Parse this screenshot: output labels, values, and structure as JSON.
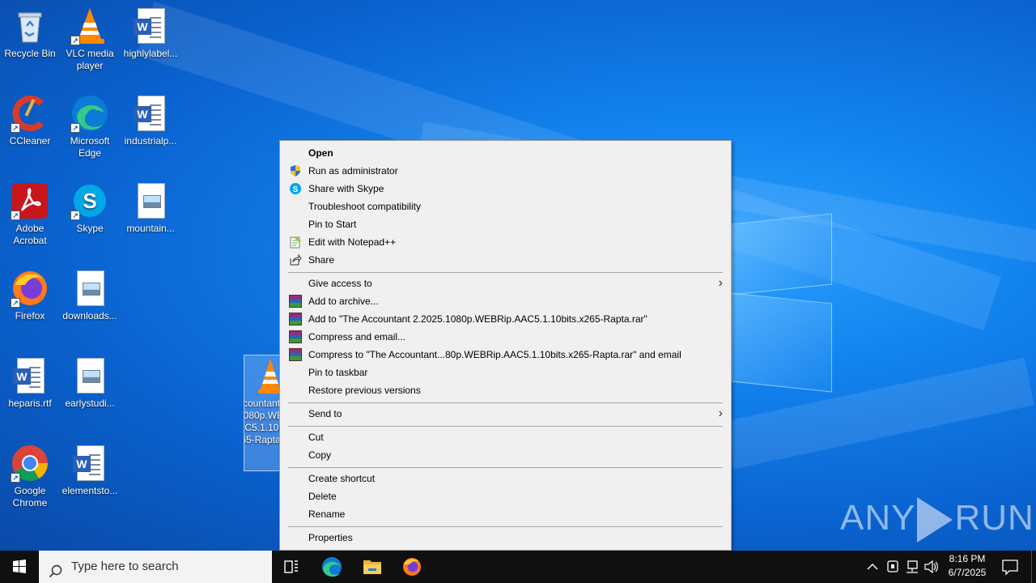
{
  "desktop": {
    "icons": [
      {
        "label": "Recycle Bin"
      },
      {
        "label": "VLC media player"
      },
      {
        "label": "highlylabel..."
      },
      {
        "label": "CCleaner"
      },
      {
        "label": "Microsoft Edge"
      },
      {
        "label": "industrialp..."
      },
      {
        "label": "Adobe Acrobat"
      },
      {
        "label": "Skype"
      },
      {
        "label": "mountain..."
      },
      {
        "label": "Firefox"
      },
      {
        "label": "downloads..."
      },
      {
        "label": "heparis.rtf"
      },
      {
        "label": "earlystudi..."
      },
      {
        "label": "Google Chrome"
      },
      {
        "label": "elementsto..."
      }
    ],
    "selected_file_label": "The Accountant 2.2025.1080p.WEBRip.AAC5.1.10bits.x265-Rapta"
  },
  "context_menu": {
    "items": [
      {
        "label": "Open"
      },
      {
        "label": "Run as administrator",
        "icon": "uac-shield-icon"
      },
      {
        "label": "Share with Skype",
        "icon": "skype-icon"
      },
      {
        "label": "Troubleshoot compatibility"
      },
      {
        "label": "Pin to Start"
      },
      {
        "label": "Edit with Notepad++",
        "icon": "notepadpp-icon"
      },
      {
        "label": "Share",
        "icon": "share-icon"
      },
      {
        "label": "Give access to"
      },
      {
        "label": "Add to archive...",
        "icon": "winrar-icon"
      },
      {
        "label": "Add to \"The Accountant 2.2025.1080p.WEBRip.AAC5.1.10bits.x265-Rapta.rar\"",
        "icon": "winrar-icon"
      },
      {
        "label": "Compress and email...",
        "icon": "winrar-icon"
      },
      {
        "label": "Compress to \"The Accountant...80p.WEBRip.AAC5.1.10bits.x265-Rapta.rar\" and email",
        "icon": "winrar-icon"
      },
      {
        "label": "Pin to taskbar"
      },
      {
        "label": "Restore previous versions"
      },
      {
        "label": "Send to"
      },
      {
        "label": "Cut"
      },
      {
        "label": "Copy"
      },
      {
        "label": "Create shortcut"
      },
      {
        "label": "Delete"
      },
      {
        "label": "Rename"
      },
      {
        "label": "Properties"
      }
    ]
  },
  "watermark": {
    "left": "ANY",
    "right": "RUN"
  },
  "taskbar": {
    "search_placeholder": "Type here to search",
    "time": "8:16 PM",
    "date": "6/7/2025"
  },
  "colors": {
    "accent": "#0a6fd8",
    "taskbar": "#101010",
    "menu_bg": "#f0f0f0"
  }
}
